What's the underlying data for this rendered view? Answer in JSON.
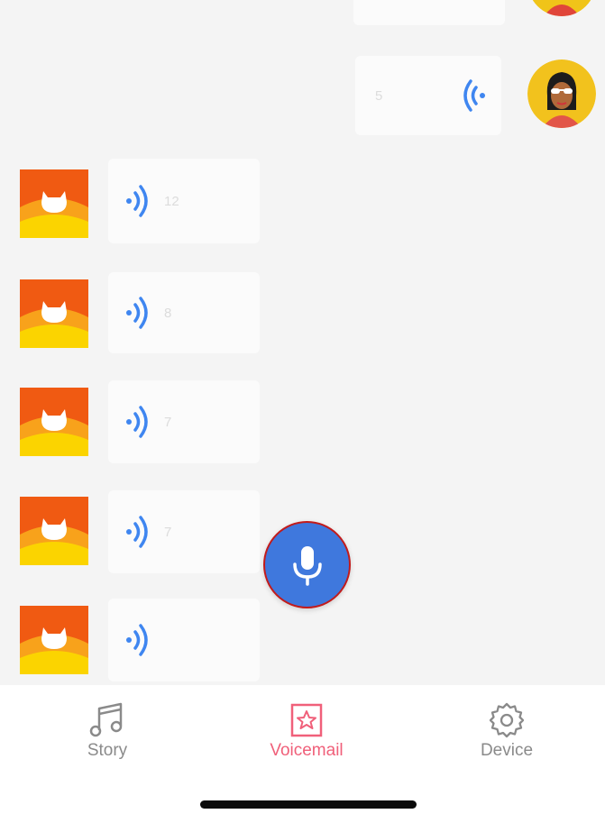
{
  "chat": {
    "sent": [
      {
        "duration": "",
        "partial": true
      },
      {
        "duration": "5"
      }
    ],
    "received": [
      {
        "duration": "12"
      },
      {
        "duration": "8"
      },
      {
        "duration": "7"
      },
      {
        "duration": "7"
      },
      {
        "duration": ""
      }
    ]
  },
  "record_button": {
    "icon": "microphone-icon",
    "color": "#3f78dd"
  },
  "tabs": [
    {
      "label": "Story",
      "icon": "music-note-icon",
      "active": false
    },
    {
      "label": "Voicemail",
      "icon": "star-box-icon",
      "active": true
    },
    {
      "label": "Device",
      "icon": "gear-icon",
      "active": false
    }
  ],
  "colors": {
    "accent_active": "#f0607a",
    "wave_blue": "#3f86f0",
    "robot_orange": "#f05a12"
  }
}
